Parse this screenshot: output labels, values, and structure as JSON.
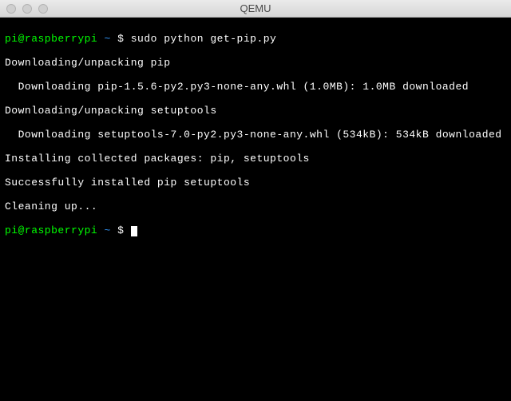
{
  "window": {
    "title": "QEMU"
  },
  "terminal": {
    "prompt1": {
      "user": "pi@raspberrypi",
      "path": " ~ ",
      "symbol": "$ ",
      "command": "sudo python get-pip.py"
    },
    "output": [
      "Downloading/unpacking pip",
      "  Downloading pip-1.5.6-py2.py3-none-any.whl (1.0MB): 1.0MB downloaded",
      "Downloading/unpacking setuptools",
      "  Downloading setuptools-7.0-py2.py3-none-any.whl (534kB): 534kB downloaded",
      "Installing collected packages: pip, setuptools",
      "Successfully installed pip setuptools",
      "Cleaning up..."
    ],
    "prompt2": {
      "user": "pi@raspberrypi",
      "path": " ~ ",
      "symbol": "$ "
    }
  }
}
